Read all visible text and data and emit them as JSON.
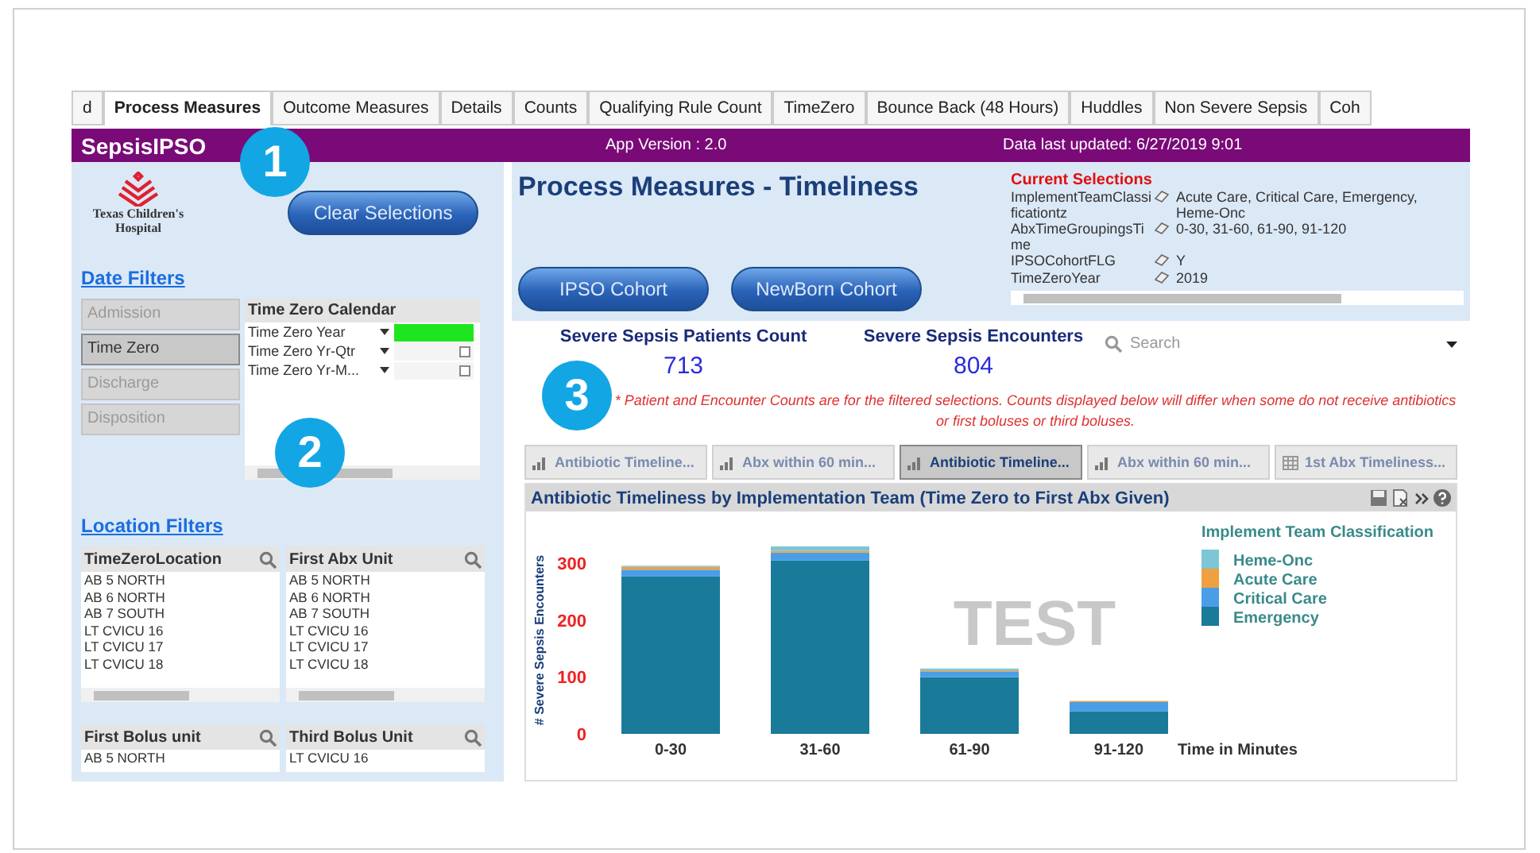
{
  "tabs": [
    {
      "label": "d",
      "selected": false
    },
    {
      "label": "Process Measures",
      "selected": true
    },
    {
      "label": "Outcome Measures",
      "selected": false
    },
    {
      "label": "Details",
      "selected": false
    },
    {
      "label": "Counts",
      "selected": false
    },
    {
      "label": "Qualifying Rule Count",
      "selected": false
    },
    {
      "label": "TimeZero",
      "selected": false
    },
    {
      "label": "Bounce Back (48 Hours)",
      "selected": false
    },
    {
      "label": "Huddles",
      "selected": false
    },
    {
      "label": "Non Severe Sepsis",
      "selected": false
    },
    {
      "label": "Coh",
      "selected": false
    }
  ],
  "app_bar": {
    "title": "SepsisIPSO",
    "version": "App Version : 2.0",
    "updated": "Data last updated:  6/27/2019 9:01"
  },
  "logo": {
    "line_1": "Texas Children's",
    "line_2": "Hospital"
  },
  "clear_button": "Clear  Selections",
  "date_filters": {
    "heading": "Date Filters",
    "options": [
      {
        "label": "Admission",
        "selected": false
      },
      {
        "label": "Time Zero",
        "selected": true
      },
      {
        "label": "Discharge",
        "selected": false
      },
      {
        "label": "Disposition",
        "selected": false
      }
    ],
    "calendar": {
      "title": "Time Zero Calendar",
      "rows": [
        {
          "label": "Time Zero Year",
          "selected": true
        },
        {
          "label": "Time Zero Yr-Qtr",
          "selected": false
        },
        {
          "label": "Time Zero Yr-M...",
          "selected": false
        }
      ]
    }
  },
  "location_filters": {
    "heading": "Location Filters",
    "lists": [
      {
        "title": "TimeZeroLocation",
        "items": [
          "AB 5 NORTH",
          "AB 6 NORTH",
          "AB 7 SOUTH",
          "LT CVICU 16",
          "LT CVICU 17",
          "LT CVICU 18"
        ]
      },
      {
        "title": "First Abx Unit",
        "items": [
          "AB 5 NORTH",
          "AB 6 NORTH",
          "AB 7 SOUTH",
          "LT CVICU 16",
          "LT CVICU 17",
          "LT CVICU 18"
        ]
      },
      {
        "title": "First Bolus unit",
        "items": [
          "AB 5 NORTH"
        ]
      },
      {
        "title": "Third Bolus Unit",
        "items": [
          "LT CVICU 16"
        ]
      }
    ]
  },
  "page_title": "Process Measures - Timeliness",
  "cohort_buttons": [
    "IPSO Cohort",
    "NewBorn Cohort"
  ],
  "current_selections": {
    "title": "Current Selections",
    "rows": [
      {
        "field": "ImplementTeamClassificationtz",
        "value": "Acute Care, Critical Care, Emergency, Heme-Onc"
      },
      {
        "field": "AbxTimeGroupingsTime",
        "value": "0-30, 31-60, 61-90, 91-120"
      },
      {
        "field": "IPSOCohortFLG",
        "value": "Y"
      },
      {
        "field": "TimeZeroYear",
        "value": "2019"
      }
    ]
  },
  "counts": [
    {
      "label": "Severe Sepsis Patients Count",
      "value": "713"
    },
    {
      "label": "Severe Sepsis Encounters",
      "value": "804"
    }
  ],
  "search": {
    "placeholder": "Search"
  },
  "note": "* Patient and Encounter Counts are for the filtered selections. Counts displayed below will differ when some do not receive antibiotics or first boluses or third boluses.",
  "chart_tabs": [
    {
      "label": "Antibiotic Timeline...",
      "kind": "chart",
      "selected": false
    },
    {
      "label": "Abx within 60 min...",
      "kind": "chart",
      "selected": false
    },
    {
      "label": "Antibiotic Timeline...",
      "kind": "chart",
      "selected": true
    },
    {
      "label": "Abx within 60 min...",
      "kind": "chart",
      "selected": false
    },
    {
      "label": "1st Abx Timeliness...",
      "kind": "table",
      "selected": false
    }
  ],
  "chart": {
    "title": "Antibiotic Timeliness by Implementation Team (Time Zero to First Abx Given)",
    "background_text": "TEST",
    "chart_data": {
      "type": "bar",
      "stacked": true,
      "xlabel": "Time in Minutes",
      "ylabel": "# Severe Sepsis Encounters",
      "legend": {
        "title": "Implement Team Classification"
      },
      "categories": [
        "0-30",
        "31-60",
        "61-90",
        "91-120"
      ],
      "ylim": [
        0,
        330
      ],
      "yticks": [
        0,
        100,
        200,
        300
      ],
      "series": [
        {
          "name": "Emergency",
          "color": "#1a7a9a",
          "values": [
            277,
            305,
            100,
            40
          ]
        },
        {
          "name": "Critical Care",
          "color": "#4a9ee8",
          "values": [
            12,
            14,
            10,
            16
          ]
        },
        {
          "name": "Acute Care",
          "color": "#f0a040",
          "values": [
            5,
            3,
            2,
            2
          ]
        },
        {
          "name": "Heme-Onc",
          "color": "#7cc6d6",
          "values": [
            2,
            8,
            3,
            0
          ]
        }
      ]
    }
  },
  "callouts": [
    "1",
    "2",
    "3"
  ]
}
